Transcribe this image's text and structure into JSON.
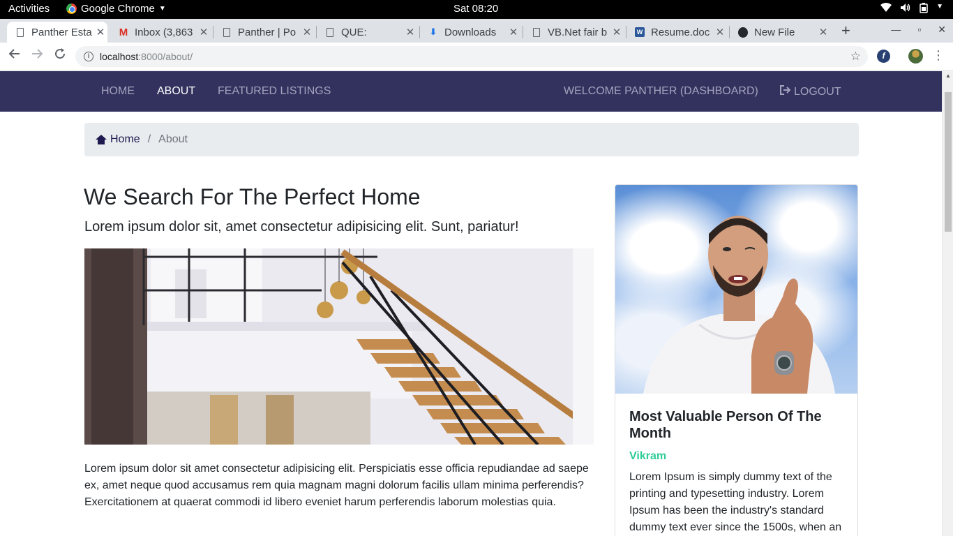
{
  "system_bar": {
    "activities": "Activities",
    "app_name": "Google Chrome",
    "clock": "Sat 08:20"
  },
  "browser": {
    "tabs": [
      {
        "title": "Panther Esta",
        "icon": "page-icon",
        "active": true
      },
      {
        "title": "Inbox (3,863",
        "icon": "gmail-icon",
        "active": false
      },
      {
        "title": "Panther | Po",
        "icon": "page-icon",
        "active": false
      },
      {
        "title": "QUE:",
        "icon": "page-icon",
        "active": false
      },
      {
        "title": "Downloads",
        "icon": "download-icon",
        "active": false
      },
      {
        "title": "VB.Net fair b",
        "icon": "page-icon",
        "active": false
      },
      {
        "title": "Resume.doc",
        "icon": "word-icon",
        "active": false
      },
      {
        "title": "New File",
        "icon": "github-icon",
        "active": false
      }
    ],
    "url_host": "localhost",
    "url_path": ":8000/about/"
  },
  "navbar": {
    "links": {
      "home": "HOME",
      "about": "ABOUT",
      "featured": "FEATURED LISTINGS",
      "dashboard": "WELCOME PANTHER (DASHBOARD)",
      "logout": "LOGOUT"
    },
    "active": "about"
  },
  "breadcrumb": {
    "home": "Home",
    "current": "About"
  },
  "about": {
    "title": "We Search For The Perfect Home",
    "lead": "Lorem ipsum dolor sit, amet consectetur adipisicing elit. Sunt, pariatur!",
    "body": "Lorem ipsum dolor sit amet consectetur adipisicing elit. Perspiciatis esse officia repudiandae ad saepe ex, amet neque quod accusamus rem quia magnam magni dolorum facilis ullam minima perferendis? Exercitationem at quaerat commodi id libero eveniet harum perferendis laborum molestias quia."
  },
  "mvp": {
    "title": "Most Valuable Person Of The Month",
    "name": "Vikram",
    "text": "Lorem Ipsum is simply dummy text of the printing and typesetting industry. Lorem Ipsum has been the industry's standard dummy text ever since the 1500s, when an"
  },
  "colors": {
    "navbar_bg": "#33325f",
    "navbar_link": "#a3a3be",
    "navbar_active": "#ffffff",
    "breadcrumb_bg": "#e9ecef",
    "accent_green": "#2ecc98"
  }
}
